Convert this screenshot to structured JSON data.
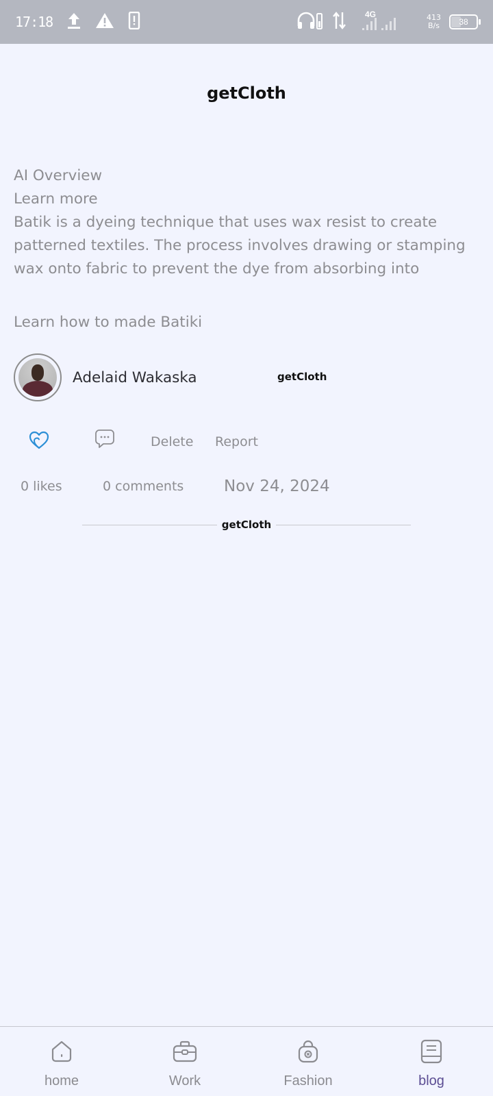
{
  "status_bar": {
    "time": "17:18",
    "speed_top": "413",
    "speed_bottom": "B/s",
    "network": "4G",
    "battery": "38"
  },
  "header": {
    "title": "getCloth"
  },
  "post": {
    "lines": [
      "AI Overview",
      "Learn more",
      "Batik is a dyeing technique that uses wax resist to create patterned textiles. The process involves drawing or stamping wax onto fabric to prevent the dye from absorbing into"
    ],
    "title": "Learn how to made Batiki",
    "author": "Adelaid Wakaska",
    "brand": "getCloth",
    "actions": {
      "delete_label": "Delete",
      "report_label": "Report"
    },
    "likes": "0 likes",
    "comments": "0 comments",
    "date": "Nov 24, 2024"
  },
  "divider": {
    "brand": "getCloth"
  },
  "bottom_nav": {
    "items": [
      {
        "label": "home",
        "icon": "home-icon"
      },
      {
        "label": "Work",
        "icon": "briefcase-icon"
      },
      {
        "label": "Fashion",
        "icon": "shopping-bag-icon"
      },
      {
        "label": "blog",
        "icon": "book-icon",
        "active": true
      }
    ]
  },
  "colors": {
    "background": "#f2f4fe",
    "status_bar": "#b4b7c0",
    "muted_text": "#8d8d91",
    "active_nav": "#5b4d93",
    "like_icon": "#2c8fd6"
  }
}
